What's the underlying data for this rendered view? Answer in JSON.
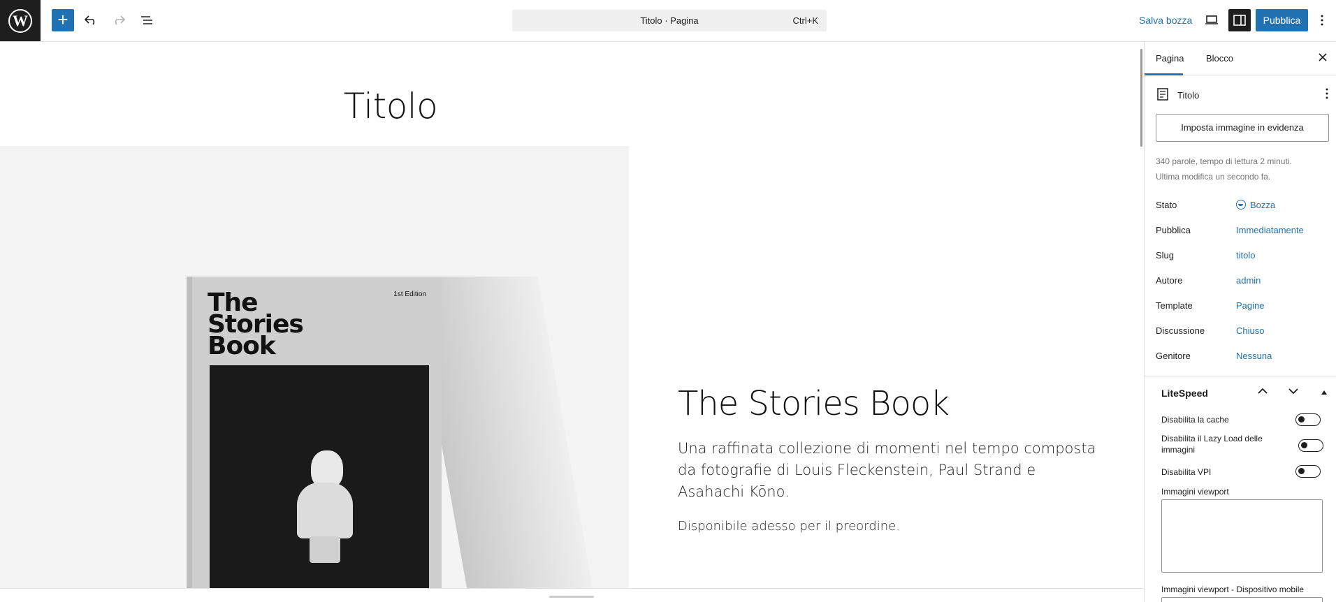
{
  "topbar": {
    "command_title": "Titolo · Pagina",
    "command_shortcut": "Ctrl+K",
    "save_draft": "Salva bozza",
    "publish": "Pubblica"
  },
  "canvas": {
    "page_title": "Titolo",
    "book": {
      "edition": "1st Edition",
      "title_lines": [
        "The",
        "Stories",
        "Book"
      ]
    },
    "hero_title": "The Stories Book",
    "hero_description": "Una raffinata collezione di momenti nel tempo composta da fotografie di Louis Fleckenstein, Paul Strand e Asahachi Kōno.",
    "hero_cta": "Disponibile adesso per il preordine."
  },
  "sidebar": {
    "tabs": [
      "Pagina",
      "Blocco"
    ],
    "doc_title": "Titolo",
    "featured_image_button": "Imposta immagine in evidenza",
    "meta_words": "340 parole, tempo di lettura 2 minuti.",
    "meta_modified": "Ultima modifica un secondo fa.",
    "properties": [
      {
        "label": "Stato",
        "value": "Bozza"
      },
      {
        "label": "Pubblica",
        "value": "Immediatamente"
      },
      {
        "label": "Slug",
        "value": "titolo"
      },
      {
        "label": "Autore",
        "value": "admin"
      },
      {
        "label": "Template",
        "value": "Pagine"
      },
      {
        "label": "Discussione",
        "value": "Chiuso"
      },
      {
        "label": "Genitore",
        "value": "Nessuna"
      }
    ],
    "litespeed": {
      "title": "LiteSpeed",
      "toggles": [
        {
          "label": "Disabilita la cache"
        },
        {
          "label": "Disabilita il Lazy Load delle immagini"
        },
        {
          "label": "Disabilita VPI"
        }
      ],
      "viewport_images_label": "Immagini viewport",
      "viewport_images_mobile_label": "Immagini viewport - Dispositivo mobile"
    }
  }
}
